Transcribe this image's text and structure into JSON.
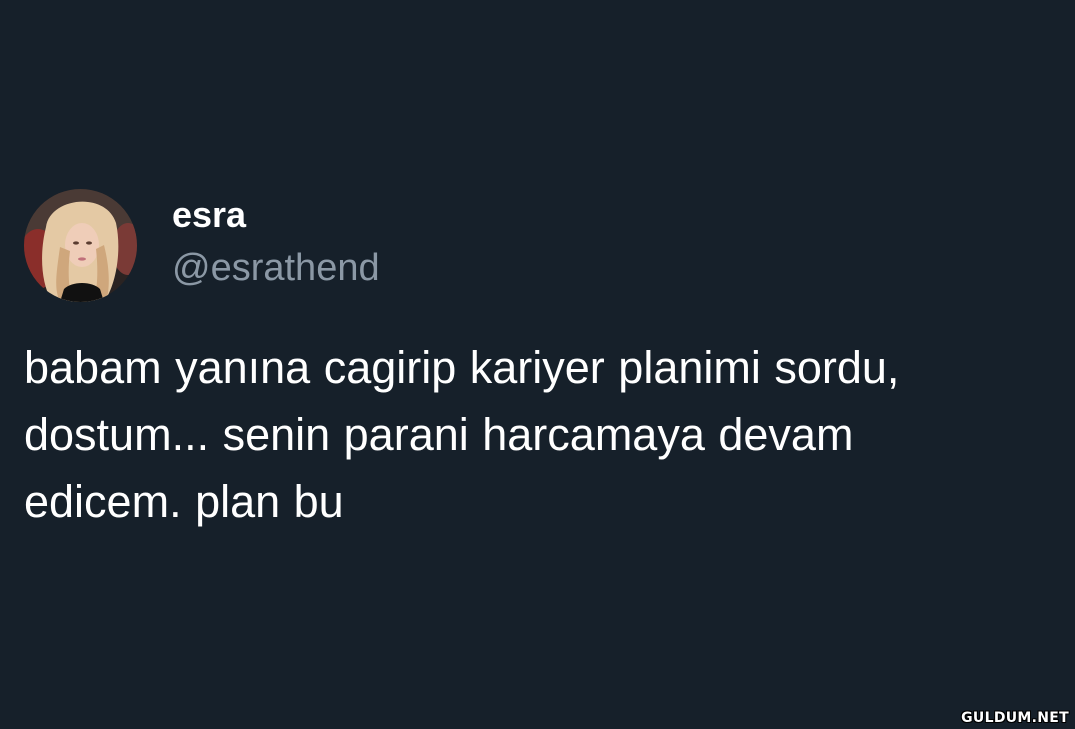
{
  "theme": {
    "background": "#16202a",
    "primary_text": "#ffffff",
    "secondary_text": "#8b98a5"
  },
  "tweet": {
    "author": {
      "display_name": "esra",
      "handle": "@esrathend",
      "avatar": "profile-photo-avatar"
    },
    "text": "babam yanına cagirip kariyer planimi sordu,\ndostum... senin parani harcamaya devam\nedicem. plan bu"
  },
  "watermark": {
    "text": "GULDUM.NET"
  }
}
